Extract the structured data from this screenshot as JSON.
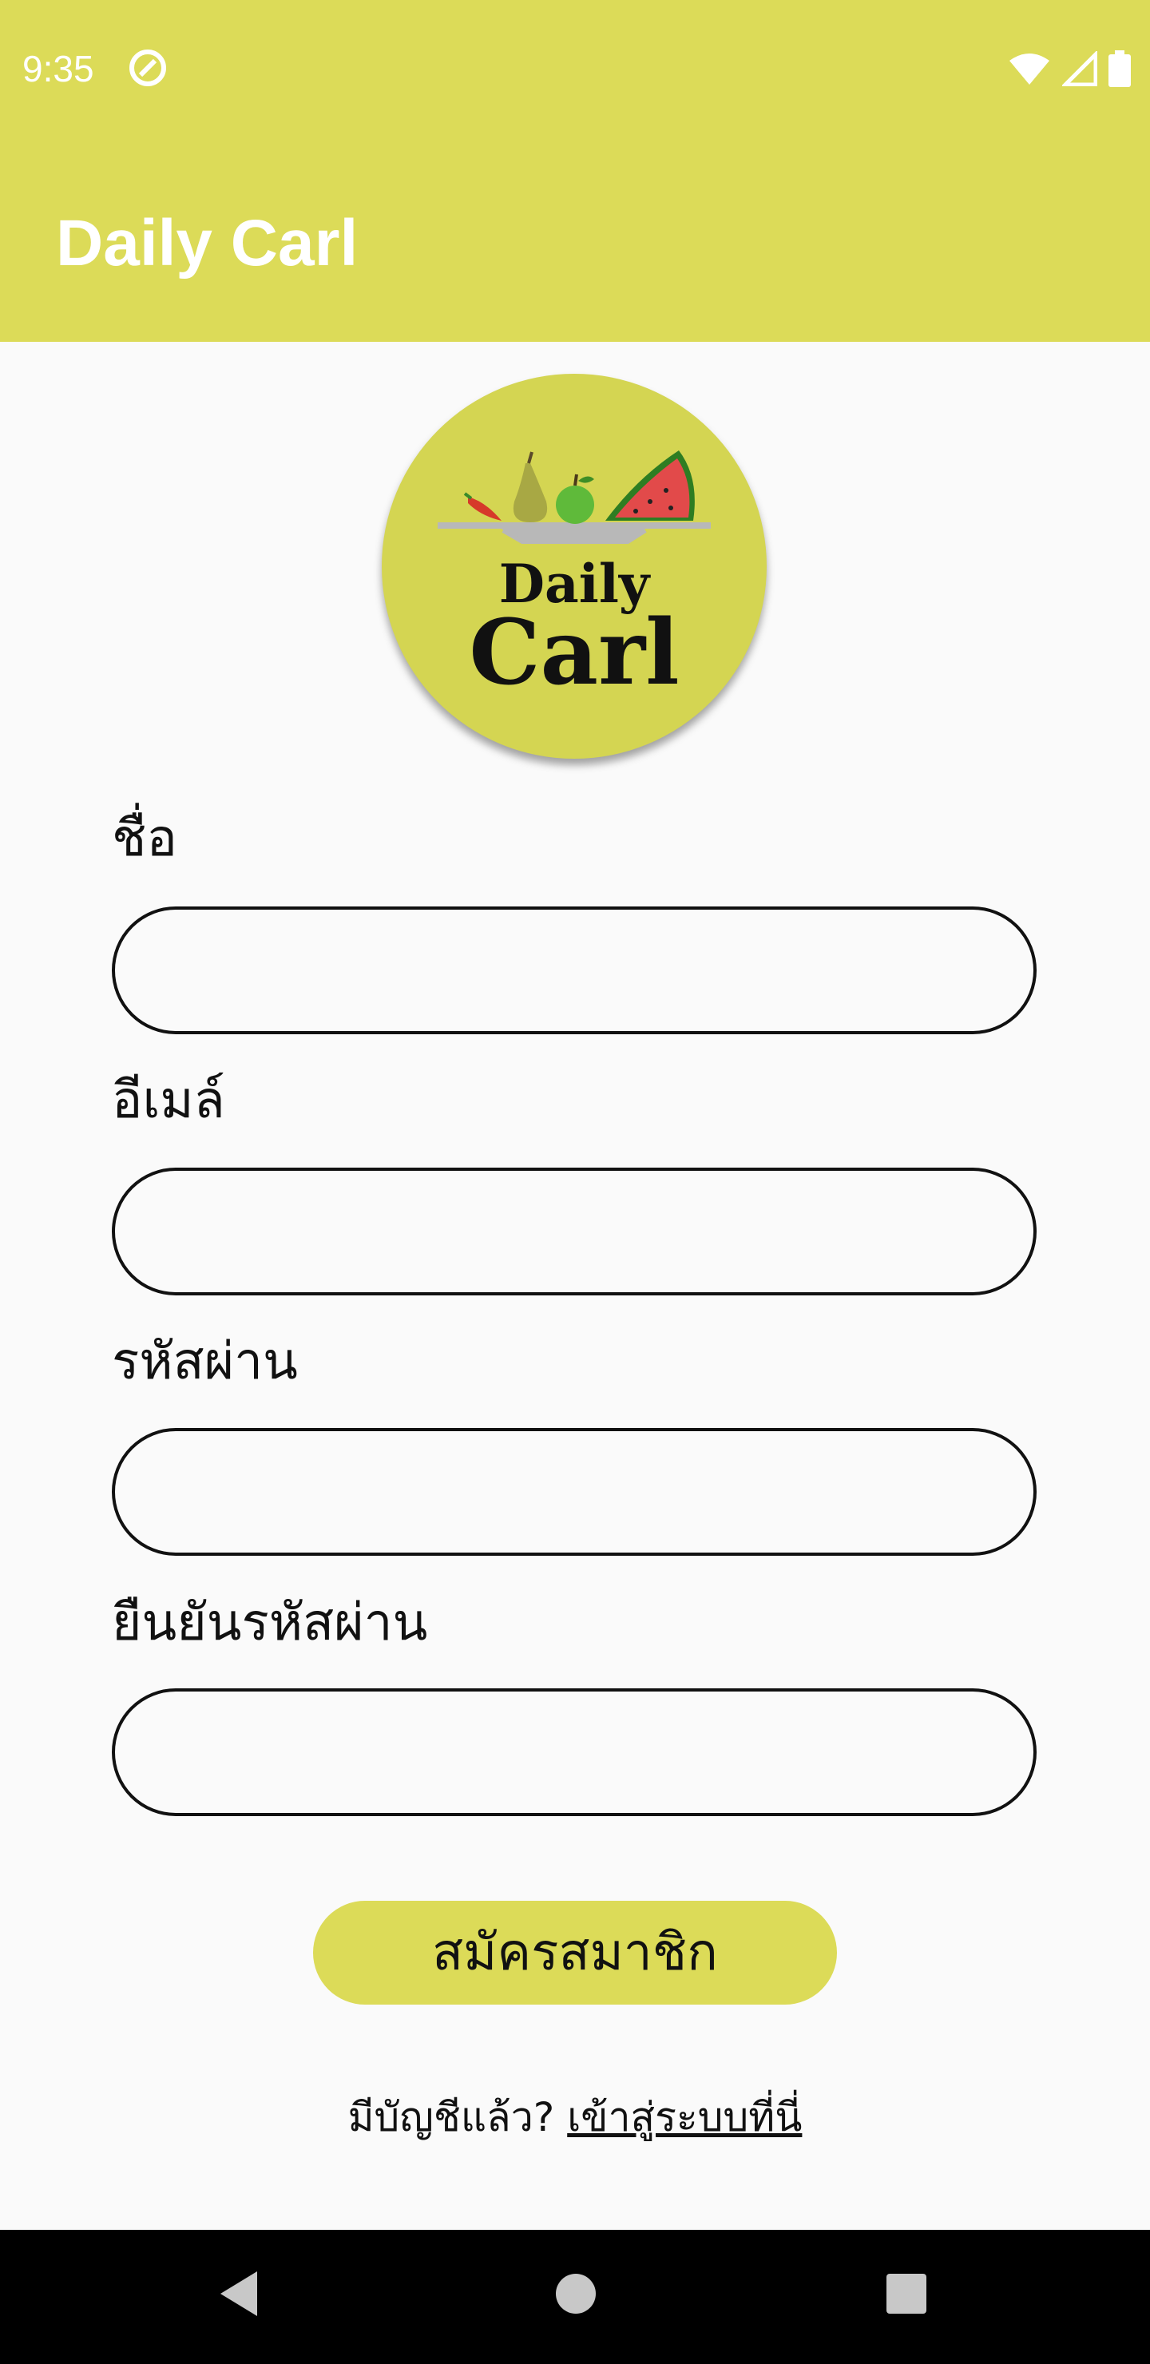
{
  "status_bar": {
    "time": "9:35",
    "notification_icon": "circle-at-icon",
    "wifi_icon": "wifi-icon",
    "signal_icon": "signal-icon",
    "battery_icon": "battery-icon"
  },
  "app_bar": {
    "title": "Daily Carl"
  },
  "logo": {
    "line1": "Daily",
    "line2": "Carl"
  },
  "form": {
    "name_label": "ชื่อ",
    "name_value": "",
    "email_label": "อีเมล์",
    "email_value": "",
    "password_label": "รหัสผ่าน",
    "password_value": "",
    "confirm_password_label": "ยืนยันรหัสผ่าน",
    "confirm_password_value": ""
  },
  "signup_button": {
    "label": "สมัครสมาชิก"
  },
  "login_prompt": {
    "text": "มีบัญชีแล้ว? ",
    "link": "เข้าสู่ระบบที่นี่"
  },
  "navigation": {
    "back_icon": "back-triangle-icon",
    "home_icon": "home-circle-icon",
    "recents_icon": "recents-square-icon"
  },
  "colors": {
    "accent": "#dcdb58",
    "background": "#fafafa",
    "nav_background": "#000000"
  }
}
